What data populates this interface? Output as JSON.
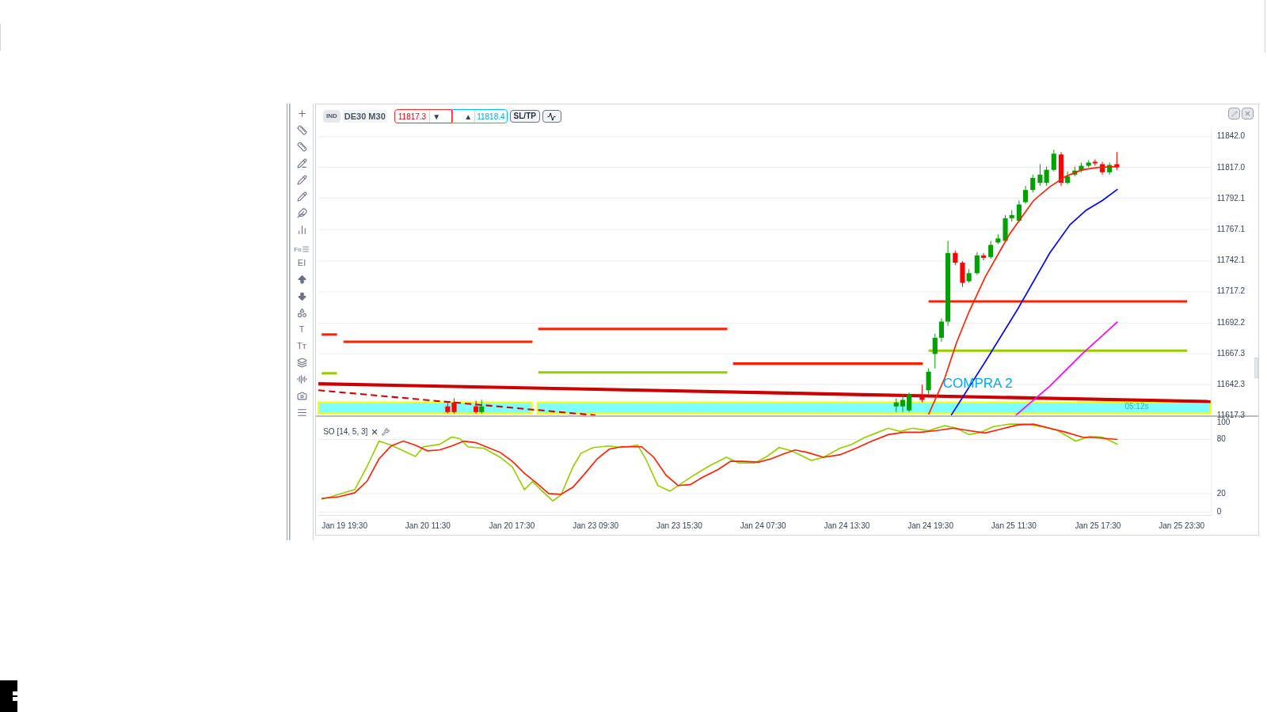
{
  "toolbar": [
    {
      "kind": "icon"
    },
    {
      "kind": "icon"
    },
    {
      "kind": "icon"
    },
    {
      "kind": "icon"
    },
    {
      "kind": "icon"
    },
    {
      "kind": "icon"
    },
    {
      "kind": "icon"
    },
    {
      "kind": "icon"
    },
    {
      "kind": "text_menu",
      "label": "Fn"
    },
    {
      "kind": "text",
      "label": "EI"
    },
    {
      "kind": "icon"
    },
    {
      "kind": "icon"
    },
    {
      "kind": "icon"
    },
    {
      "kind": "text",
      "label": "T"
    },
    {
      "kind": "text",
      "label": "Tᴛ"
    },
    {
      "kind": "icon"
    },
    {
      "kind": "icon"
    },
    {
      "kind": "icon"
    },
    {
      "kind": "icon"
    }
  ],
  "chart": {
    "badge": "IND",
    "symbol": "DE30 M30",
    "sell_price": "11817.3",
    "sell_arrow": "▼",
    "buy_arrow": "▲",
    "buy_price": "11818.4",
    "sltp_button": "SL/TP",
    "annotation": "COMPRA 2",
    "timer": "05:12s",
    "price_ticks": [
      "11842.0",
      "11817.0",
      "11792.1",
      "11767.1",
      "11742.1",
      "11717.2",
      "11692.2",
      "11667.3",
      "11642.3",
      "11617.3"
    ],
    "dates": [
      "Jan 19 19:30",
      "Jan 20 11:30",
      "Jan 20 17:30",
      "Jan 23 09:30",
      "Jan 23 15:30",
      "Jan 24 07:30",
      "Jan 24 13:30",
      "Jan 24 19:30",
      "Jan 25 11:30",
      "Jan 25 17:30",
      "Jan 25 23:30"
    ]
  },
  "oscillator": {
    "label": "SO [14, 5, 3]",
    "ticks": [
      "100",
      "80",
      "20",
      "0"
    ]
  }
}
